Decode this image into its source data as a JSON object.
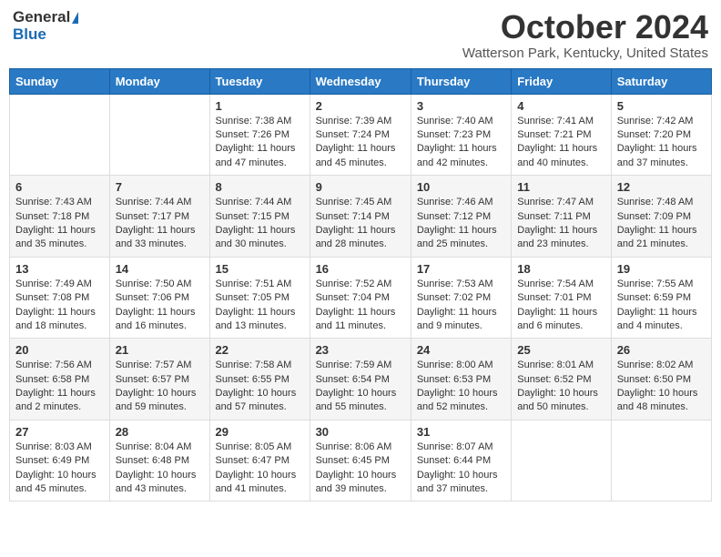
{
  "header": {
    "logo_general": "General",
    "logo_blue": "Blue",
    "month_title": "October 2024",
    "location": "Watterson Park, Kentucky, United States"
  },
  "weekdays": [
    "Sunday",
    "Monday",
    "Tuesday",
    "Wednesday",
    "Thursday",
    "Friday",
    "Saturday"
  ],
  "weeks": [
    [
      {
        "day": "",
        "info": ""
      },
      {
        "day": "",
        "info": ""
      },
      {
        "day": "1",
        "info": "Sunrise: 7:38 AM\nSunset: 7:26 PM\nDaylight: 11 hours and 47 minutes."
      },
      {
        "day": "2",
        "info": "Sunrise: 7:39 AM\nSunset: 7:24 PM\nDaylight: 11 hours and 45 minutes."
      },
      {
        "day": "3",
        "info": "Sunrise: 7:40 AM\nSunset: 7:23 PM\nDaylight: 11 hours and 42 minutes."
      },
      {
        "day": "4",
        "info": "Sunrise: 7:41 AM\nSunset: 7:21 PM\nDaylight: 11 hours and 40 minutes."
      },
      {
        "day": "5",
        "info": "Sunrise: 7:42 AM\nSunset: 7:20 PM\nDaylight: 11 hours and 37 minutes."
      }
    ],
    [
      {
        "day": "6",
        "info": "Sunrise: 7:43 AM\nSunset: 7:18 PM\nDaylight: 11 hours and 35 minutes."
      },
      {
        "day": "7",
        "info": "Sunrise: 7:44 AM\nSunset: 7:17 PM\nDaylight: 11 hours and 33 minutes."
      },
      {
        "day": "8",
        "info": "Sunrise: 7:44 AM\nSunset: 7:15 PM\nDaylight: 11 hours and 30 minutes."
      },
      {
        "day": "9",
        "info": "Sunrise: 7:45 AM\nSunset: 7:14 PM\nDaylight: 11 hours and 28 minutes."
      },
      {
        "day": "10",
        "info": "Sunrise: 7:46 AM\nSunset: 7:12 PM\nDaylight: 11 hours and 25 minutes."
      },
      {
        "day": "11",
        "info": "Sunrise: 7:47 AM\nSunset: 7:11 PM\nDaylight: 11 hours and 23 minutes."
      },
      {
        "day": "12",
        "info": "Sunrise: 7:48 AM\nSunset: 7:09 PM\nDaylight: 11 hours and 21 minutes."
      }
    ],
    [
      {
        "day": "13",
        "info": "Sunrise: 7:49 AM\nSunset: 7:08 PM\nDaylight: 11 hours and 18 minutes."
      },
      {
        "day": "14",
        "info": "Sunrise: 7:50 AM\nSunset: 7:06 PM\nDaylight: 11 hours and 16 minutes."
      },
      {
        "day": "15",
        "info": "Sunrise: 7:51 AM\nSunset: 7:05 PM\nDaylight: 11 hours and 13 minutes."
      },
      {
        "day": "16",
        "info": "Sunrise: 7:52 AM\nSunset: 7:04 PM\nDaylight: 11 hours and 11 minutes."
      },
      {
        "day": "17",
        "info": "Sunrise: 7:53 AM\nSunset: 7:02 PM\nDaylight: 11 hours and 9 minutes."
      },
      {
        "day": "18",
        "info": "Sunrise: 7:54 AM\nSunset: 7:01 PM\nDaylight: 11 hours and 6 minutes."
      },
      {
        "day": "19",
        "info": "Sunrise: 7:55 AM\nSunset: 6:59 PM\nDaylight: 11 hours and 4 minutes."
      }
    ],
    [
      {
        "day": "20",
        "info": "Sunrise: 7:56 AM\nSunset: 6:58 PM\nDaylight: 11 hours and 2 minutes."
      },
      {
        "day": "21",
        "info": "Sunrise: 7:57 AM\nSunset: 6:57 PM\nDaylight: 10 hours and 59 minutes."
      },
      {
        "day": "22",
        "info": "Sunrise: 7:58 AM\nSunset: 6:55 PM\nDaylight: 10 hours and 57 minutes."
      },
      {
        "day": "23",
        "info": "Sunrise: 7:59 AM\nSunset: 6:54 PM\nDaylight: 10 hours and 55 minutes."
      },
      {
        "day": "24",
        "info": "Sunrise: 8:00 AM\nSunset: 6:53 PM\nDaylight: 10 hours and 52 minutes."
      },
      {
        "day": "25",
        "info": "Sunrise: 8:01 AM\nSunset: 6:52 PM\nDaylight: 10 hours and 50 minutes."
      },
      {
        "day": "26",
        "info": "Sunrise: 8:02 AM\nSunset: 6:50 PM\nDaylight: 10 hours and 48 minutes."
      }
    ],
    [
      {
        "day": "27",
        "info": "Sunrise: 8:03 AM\nSunset: 6:49 PM\nDaylight: 10 hours and 45 minutes."
      },
      {
        "day": "28",
        "info": "Sunrise: 8:04 AM\nSunset: 6:48 PM\nDaylight: 10 hours and 43 minutes."
      },
      {
        "day": "29",
        "info": "Sunrise: 8:05 AM\nSunset: 6:47 PM\nDaylight: 10 hours and 41 minutes."
      },
      {
        "day": "30",
        "info": "Sunrise: 8:06 AM\nSunset: 6:45 PM\nDaylight: 10 hours and 39 minutes."
      },
      {
        "day": "31",
        "info": "Sunrise: 8:07 AM\nSunset: 6:44 PM\nDaylight: 10 hours and 37 minutes."
      },
      {
        "day": "",
        "info": ""
      },
      {
        "day": "",
        "info": ""
      }
    ]
  ]
}
